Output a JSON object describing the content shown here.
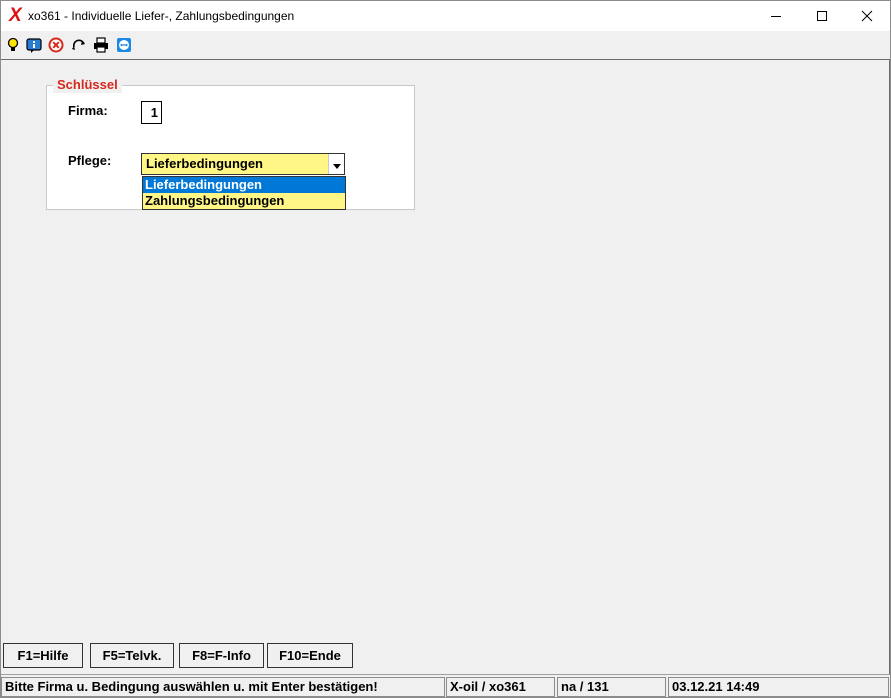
{
  "window": {
    "title": "xo361 - Individuelle Liefer-, Zahlungsbedingungen",
    "logo_text": "X",
    "controls": [
      "minimize-icon",
      "maximize-icon",
      "close-icon"
    ]
  },
  "toolbar": {
    "icons": [
      "lightbulb-icon",
      "info-icon",
      "cancel-icon",
      "refresh-icon",
      "printer-icon",
      "teamviewer-icon"
    ]
  },
  "group": {
    "legend": "Schlüssel",
    "firma_label": "Firma:",
    "firma_value": "1",
    "pflege_label": "Pflege:",
    "pflege_selected": "Lieferbedingungen",
    "pflege_options": [
      "Lieferbedingungen",
      "Zahlungsbedingungen"
    ]
  },
  "function_keys": [
    "F1=Hilfe",
    "F5=Telvk.",
    "F8=F-Info",
    "F10=Ende"
  ],
  "statusbar": {
    "message": "Bitte Firma u. Bedingung auswählen u. mit Enter bestätigen!",
    "app": "X-oil / xo361",
    "user": "na / 131",
    "datetime": "03.12.21 14:49"
  },
  "colors": {
    "legend": "#d42a1e",
    "field_highlight": "#fff685",
    "selection": "#0078d7",
    "logo": "#e01010"
  }
}
